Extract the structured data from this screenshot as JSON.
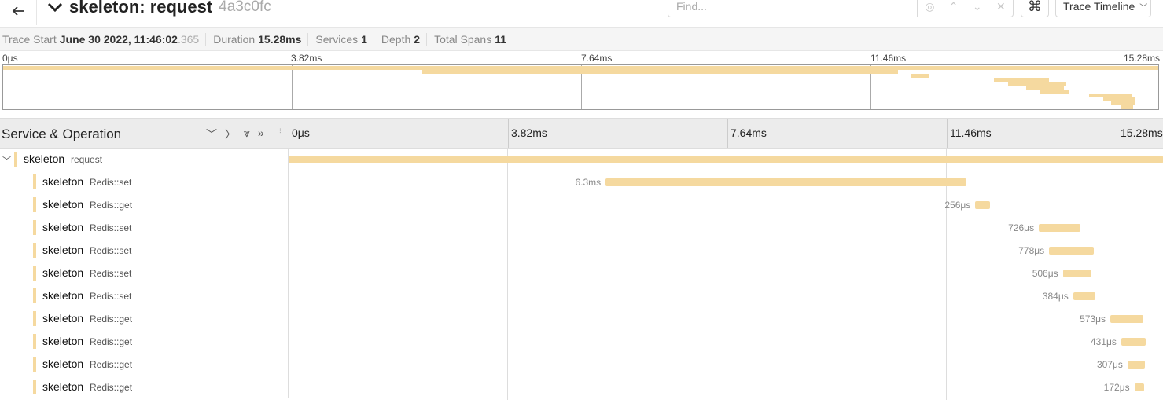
{
  "header": {
    "back_icon": "arrow-left-icon",
    "title": "skeleton: request",
    "trace_id": "4a3c0fc",
    "find_placeholder": "Find...",
    "cmd_glyph": "⌘",
    "view_label": "Trace Timeline"
  },
  "summary": {
    "trace_start_label": "Trace Start",
    "trace_start_value": "June 30 2022, 11:46:02",
    "trace_start_ms": ".365",
    "duration_label": "Duration",
    "duration_value": "15.28ms",
    "services_label": "Services",
    "services_value": "1",
    "depth_label": "Depth",
    "depth_value": "2",
    "total_spans_label": "Total Spans",
    "total_spans_value": "11"
  },
  "ticks": [
    "0μs",
    "3.82ms",
    "7.64ms",
    "11.46ms",
    "15.28ms"
  ],
  "timeline_header": {
    "title": "Service & Operation"
  },
  "colors": {
    "span": "#f5d99f"
  },
  "total_ms": 15.28,
  "spans": [
    {
      "service": "skeleton",
      "operation": "request",
      "start_ms": 0,
      "duration_ms": 15.28,
      "label": "",
      "depth": 0
    },
    {
      "service": "skeleton",
      "operation": "Redis::set",
      "start_ms": 5.54,
      "duration_ms": 6.3,
      "label": "6.3ms",
      "depth": 1
    },
    {
      "service": "skeleton",
      "operation": "Redis::get",
      "start_ms": 12.0,
      "duration_ms": 0.256,
      "label": "256μs",
      "depth": 1
    },
    {
      "service": "skeleton",
      "operation": "Redis::set",
      "start_ms": 13.11,
      "duration_ms": 0.726,
      "label": "726μs",
      "depth": 1
    },
    {
      "service": "skeleton",
      "operation": "Redis::set",
      "start_ms": 13.29,
      "duration_ms": 0.778,
      "label": "778μs",
      "depth": 1
    },
    {
      "service": "skeleton",
      "operation": "Redis::set",
      "start_ms": 13.53,
      "duration_ms": 0.506,
      "label": "506μs",
      "depth": 1
    },
    {
      "service": "skeleton",
      "operation": "Redis::set",
      "start_ms": 13.71,
      "duration_ms": 0.384,
      "label": "384μs",
      "depth": 1
    },
    {
      "service": "skeleton",
      "operation": "Redis::get",
      "start_ms": 14.36,
      "duration_ms": 0.573,
      "label": "573μs",
      "depth": 1
    },
    {
      "service": "skeleton",
      "operation": "Redis::get",
      "start_ms": 14.55,
      "duration_ms": 0.431,
      "label": "431μs",
      "depth": 1
    },
    {
      "service": "skeleton",
      "operation": "Redis::get",
      "start_ms": 14.66,
      "duration_ms": 0.307,
      "label": "307μs",
      "depth": 1
    },
    {
      "service": "skeleton",
      "operation": "Redis::get",
      "start_ms": 14.78,
      "duration_ms": 0.172,
      "label": "172μs",
      "depth": 1
    }
  ]
}
